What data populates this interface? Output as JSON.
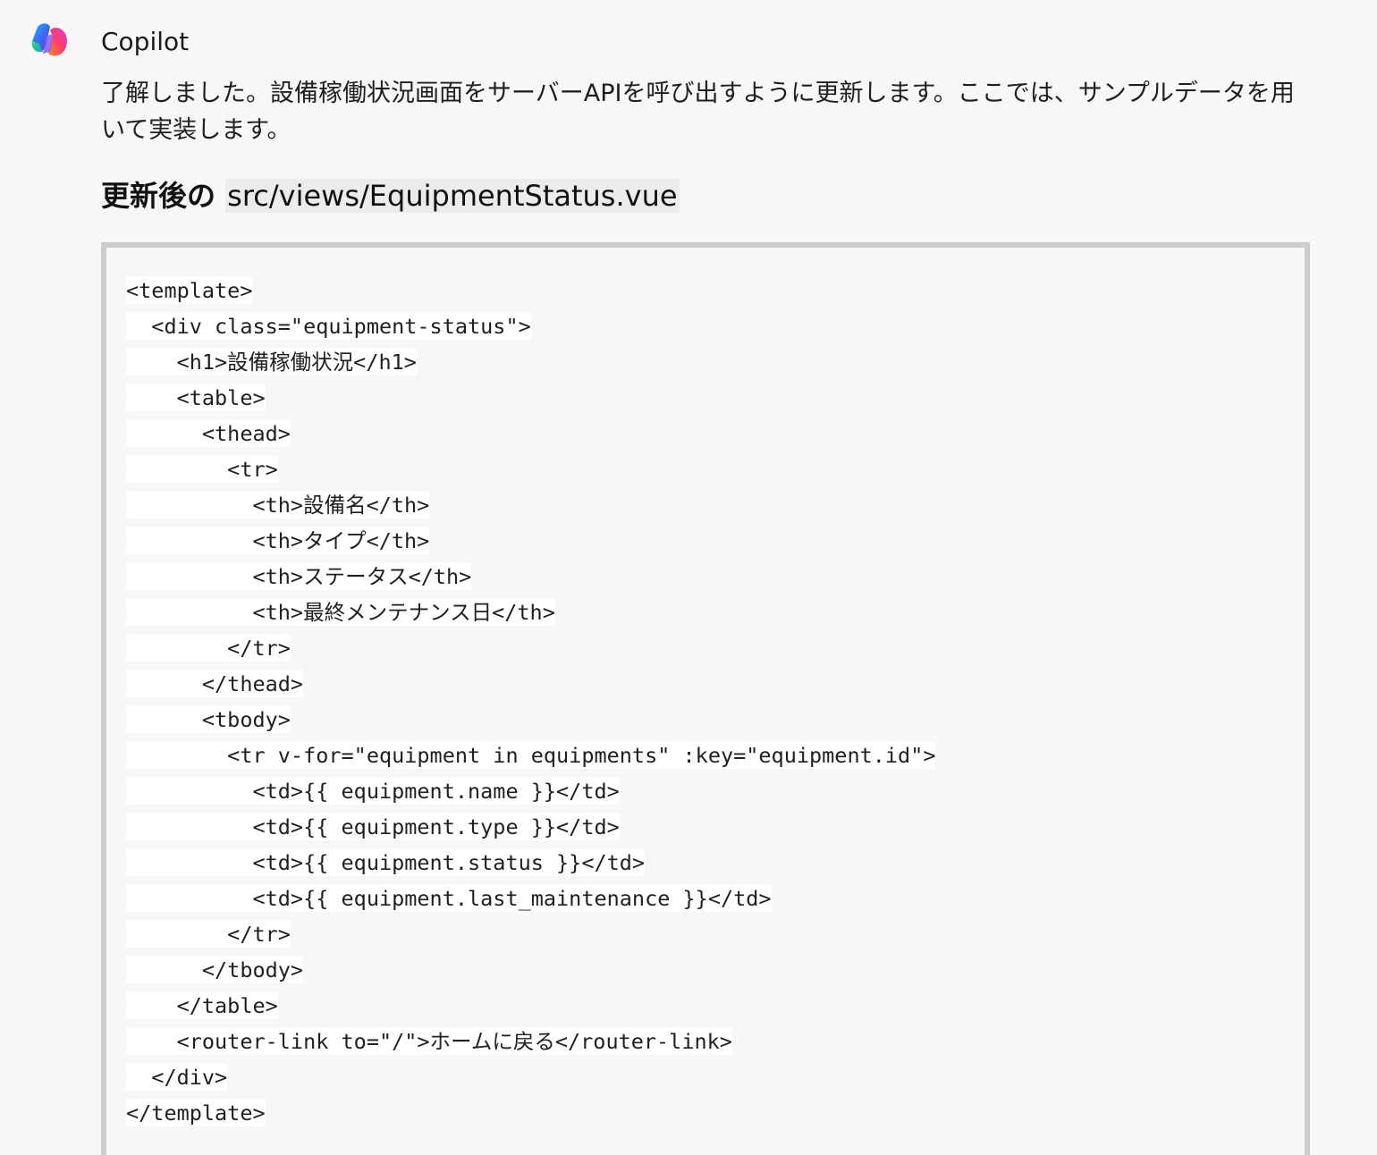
{
  "message": {
    "author": "Copilot",
    "intro": "了解しました。設備稼働状況画面をサーバーAPIを呼び出すように更新します。ここでは、サンプルデータを用いて実装します。",
    "heading_prefix": "更新後の",
    "heading_file": "src/views/EquipmentStatus.vue"
  },
  "code": {
    "lines": [
      "<template>",
      "  <div class=\"equipment-status\">",
      "    <h1>設備稼働状況</h1>",
      "    <table>",
      "      <thead>",
      "        <tr>",
      "          <th>設備名</th>",
      "          <th>タイプ</th>",
      "          <th>ステータス</th>",
      "          <th>最終メンテナンス日</th>",
      "        </tr>",
      "      </thead>",
      "      <tbody>",
      "        <tr v-for=\"equipment in equipments\" :key=\"equipment.id\">",
      "          <td>{{ equipment.name }}</td>",
      "          <td>{{ equipment.type }}</td>",
      "          <td>{{ equipment.status }}</td>",
      "          <td>{{ equipment.last_maintenance }}</td>",
      "        </tr>",
      "      </tbody>",
      "    </table>",
      "    <router-link to=\"/\">ホームに戻る</router-link>",
      "  </div>",
      "</template>"
    ]
  },
  "icons": {
    "logo": "copilot-logo-icon"
  }
}
